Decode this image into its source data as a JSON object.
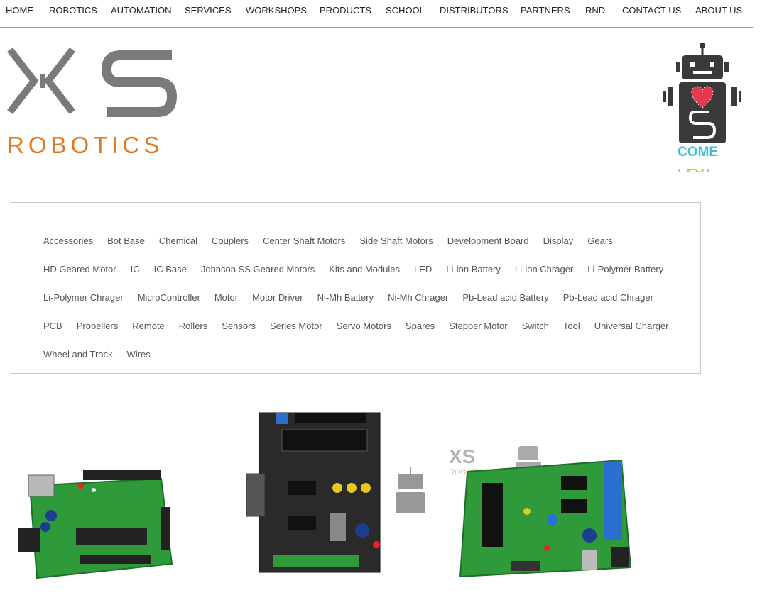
{
  "nav": [
    "HOME",
    "ROBOTICS",
    "AUTOMATION",
    "SERVICES",
    "WORKSHOPS",
    "PRODUCTS",
    "SCHOOL",
    "DISTRIBUTORS",
    "PARTNERS",
    "RND",
    "CONTACT US",
    "ABOUT US"
  ],
  "logo": {
    "line1": "XS",
    "line2": "ROBOTICS"
  },
  "mascot": {
    "line1": "COME",
    "line2": "PLAY"
  },
  "categories": [
    [
      "Accessories",
      "Bot Base",
      "Chemical",
      "Couplers",
      "Center Shaft Motors",
      "Side Shaft Motors",
      "Development Board",
      "Display",
      "Gears"
    ],
    [
      "HD Geared Motor",
      "IC",
      "IC Base",
      "Johnson SS Geared Motors",
      "Kits and Modules",
      "LED",
      "Li-ion Battery",
      "Li-ion Chrager",
      "Li-Polymer Battery"
    ],
    [
      "Li-Polymer Chrager",
      "MicroController",
      "Motor",
      "Motor Driver",
      "Ni-Mh Battery",
      "Ni-Mh Chrager",
      "Pb-Lead acid Battery",
      "Pb-Lead acid Chrager"
    ],
    [
      "PCB",
      "Propellers",
      "Remote",
      "Rollers",
      "Sensors",
      "Series Motor",
      "Servo Motors",
      "Spares",
      "Stepper Motor",
      "Switch",
      "Tool",
      "Universal Charger"
    ],
    [
      "Wheel and Track",
      "Wires"
    ]
  ],
  "colors": {
    "logo_gray": "#7a7a7a",
    "logo_orange": "#e07b22",
    "pcb_green": "#2e9a3a",
    "pcb_black": "#2a2a2a"
  },
  "products": [
    {
      "icon": "arduino-board-image"
    },
    {
      "icon": "microcontroller-board-image",
      "watermark": "robot-watermark-icon"
    },
    {
      "icon": "development-board-image",
      "watermark": "xs-robotics-watermark"
    }
  ]
}
